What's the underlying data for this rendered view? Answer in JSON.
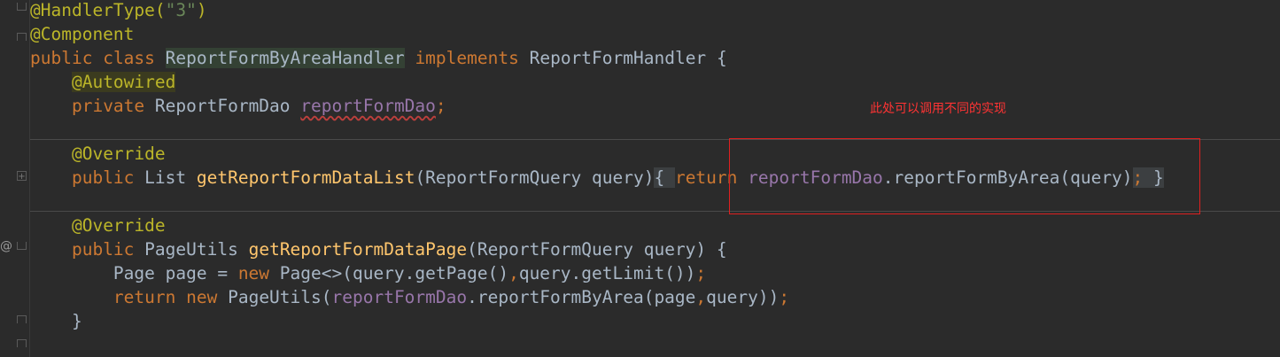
{
  "code": {
    "line1": {
      "ann": "@HandlerType(",
      "str": "\"3\"",
      "close": ")"
    },
    "line2": {
      "ann": "@Component"
    },
    "line3": {
      "kw_public": "public",
      "kw_class": "class",
      "class_name": "ReportFormByAreaHandler",
      "kw_implements": "implements",
      "iface": "ReportFormHandler",
      "brace": "{"
    },
    "line4": {
      "ann": "@Autowired"
    },
    "line5": {
      "kw": "private",
      "type": "ReportFormDao",
      "field": "reportFormDao",
      "semi": ";"
    },
    "line6": {
      "ann": "@Override"
    },
    "line7": {
      "kw": "public",
      "type": "List",
      "method": "getReportFormDataList",
      "params": "(ReportFormQuery query)",
      "open": "{ ",
      "kw_return": "return",
      "field": "reportFormDao",
      "call": ".reportFormByArea(query)",
      "semi": ";",
      "close": " }"
    },
    "line8": {
      "ann": "@Override"
    },
    "line9": {
      "kw": "public",
      "type": "PageUtils",
      "method": "getReportFormDataPage",
      "params": "(ReportFormQuery query) {"
    },
    "line10": {
      "type": "Page page = ",
      "kw_new": "new",
      "rest": " Page<>(query.getPage()",
      "comma": ",",
      "rest2": "query.getLimit())",
      "semi": ";"
    },
    "line11": {
      "kw_return": "return",
      "kw_new": "new",
      "rest": " PageUtils(",
      "field": "reportFormDao",
      "rest2": ".reportFormByArea(page",
      "comma": ",",
      "rest3": "query))",
      "semi": ";"
    },
    "line12": {
      "close": "}"
    }
  },
  "annotation_note": "此处可以调用不同的实现",
  "gutter": {
    "override_marker": "@"
  }
}
